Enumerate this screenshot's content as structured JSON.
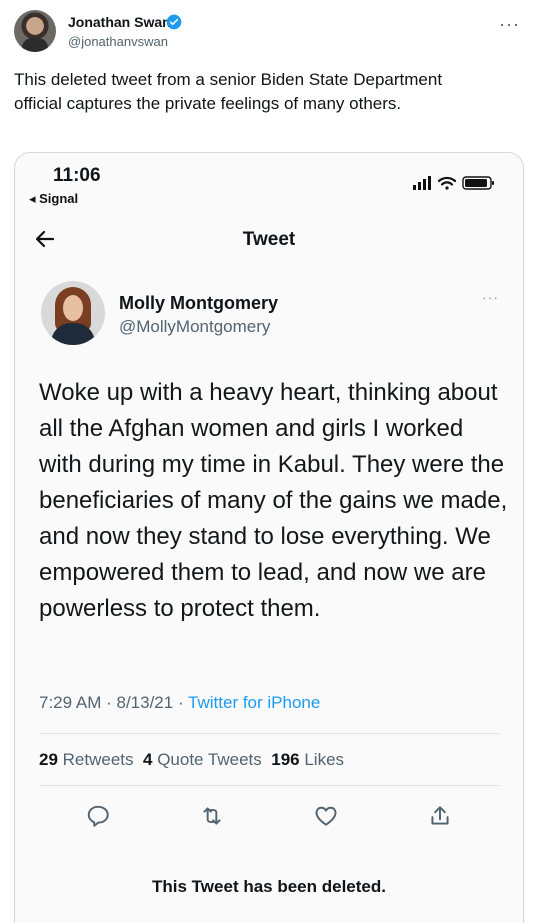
{
  "author": {
    "name": "Jonathan Swan",
    "handle": "@jonathanvswan",
    "verified": true
  },
  "tweet": {
    "text": "This deleted tweet from a senior Biden State Department official captures the private feelings of many others."
  },
  "screenshot": {
    "status_bar": {
      "time": "11:06",
      "back_app": "◂ Signal"
    },
    "nav": {
      "title": "Tweet"
    },
    "inner_tweet": {
      "name": "Molly Montgomery",
      "handle": "@MollyMontgomery",
      "text": "Woke up with a heavy heart, thinking about all the Afghan women and girls I worked with during my time in Kabul. They were the beneficiaries of many of the gains we made, and now they stand to lose everything. We empowered them to lead, and now we are powerless to protect them.",
      "time": "7:29 AM",
      "date": "8/13/21",
      "source": "Twitter for iPhone",
      "stats": {
        "retweets_count": "29",
        "retweets_label": "Retweets",
        "quotes_count": "4",
        "quotes_label": "Quote Tweets",
        "likes_count": "196",
        "likes_label": "Likes"
      },
      "deleted_notice": "This Tweet has been deleted."
    }
  },
  "colors": {
    "accent": "#1d9bf0",
    "secondary_text": "#536471",
    "primary_text": "#0f1419"
  }
}
